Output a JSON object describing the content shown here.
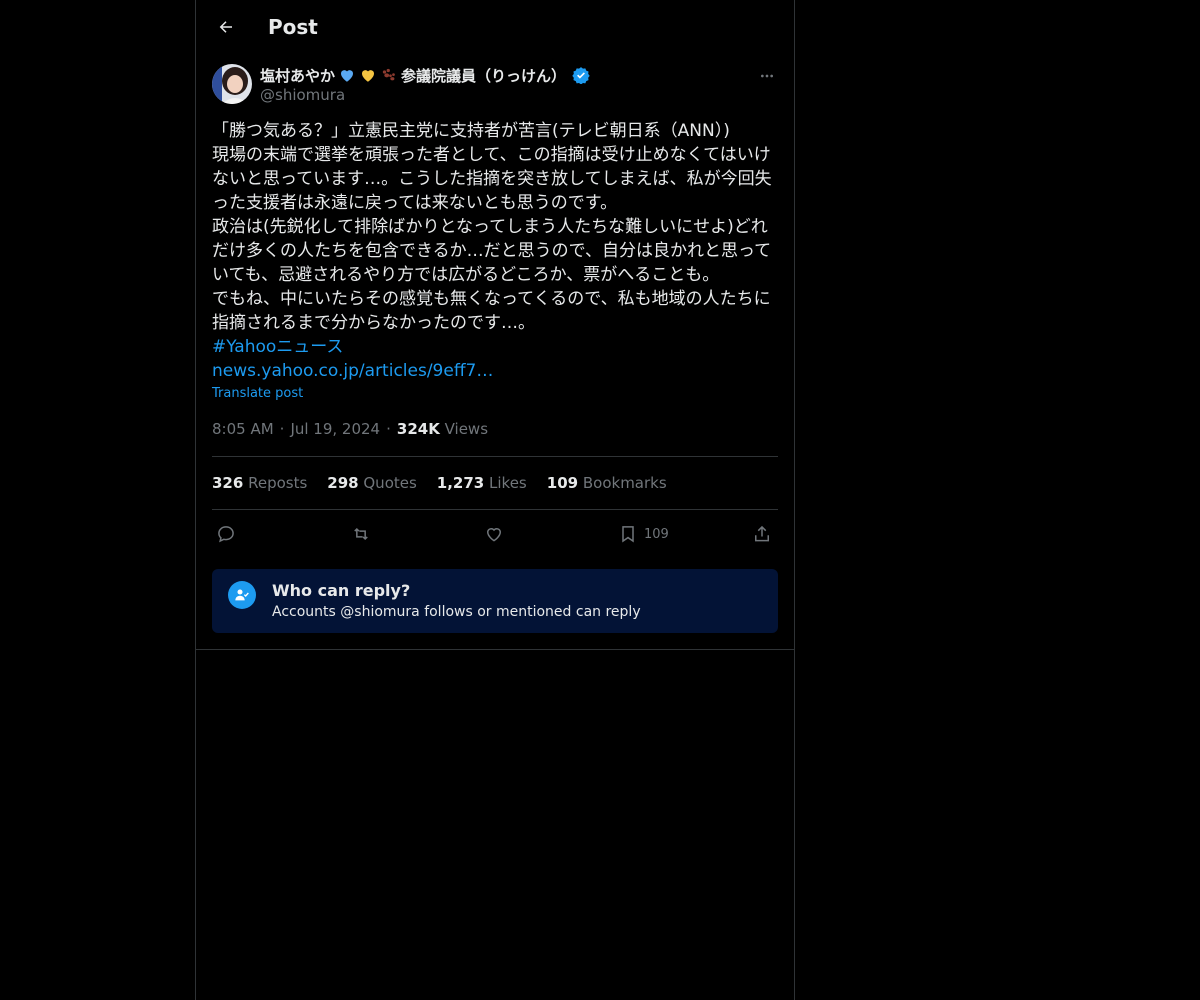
{
  "header": {
    "title": "Post"
  },
  "author": {
    "name": "塩村あやか",
    "name_suffix": "参議院議員（りっけん）",
    "handle": "@shiomura"
  },
  "post": {
    "lines": [
      "「勝つ気ある？」立憲民主党に支持者が苦言(テレビ朝日系（ANN）)",
      "現場の末端で選挙を頑張った者として、この指摘は受け止めなくてはいけ",
      "ないと思っています…。こうした指摘を突き放してしまえば、私が今回失",
      "った支援者は永遠に戻っては来ないとも思うのです。",
      "政治は(先鋭化して排除ばかりとなってしまう人たちな難しいにせよ)どれ",
      "だけ多くの人たちを包含できるか…だと思うので、自分は良かれと思って",
      "いても、忌避されるやり方では広がるどころか、票がへることも。",
      "でもね、中にいたらその感覚も無くなってくるので、私も地域の人たちに",
      "指摘されるまで分からなかったのです…。"
    ],
    "hashtag": "#Yahooニュース",
    "url": "news.yahoo.co.jp/articles/9eff7…",
    "translate": "Translate post",
    "time": "8:05 AM",
    "date": "Jul 19, 2024",
    "views_count": "324K",
    "views_label": "Views"
  },
  "stats": {
    "reposts": {
      "count": "326",
      "label": "Reposts"
    },
    "quotes": {
      "count": "298",
      "label": "Quotes"
    },
    "likes": {
      "count": "1,273",
      "label": "Likes"
    },
    "bookmarks": {
      "count": "109",
      "label": "Bookmarks"
    }
  },
  "actions": {
    "bookmark_count": "109"
  },
  "reply_restriction": {
    "title": "Who can reply?",
    "subtitle": "Accounts @shiomura follows or mentioned can reply"
  },
  "icons": {
    "back": "arrow-left-icon",
    "more": "more-horizontal-icon",
    "verified": "verified-badge-icon",
    "reply": "reply-icon",
    "repost": "repost-icon",
    "like": "heart-icon",
    "bookmark": "bookmark-icon",
    "share": "share-icon",
    "restriction": "user-check-icon"
  },
  "colors": {
    "accent": "#1d9bf0",
    "background": "#000000",
    "muted": "#71767b",
    "reply_box": "#031336"
  }
}
